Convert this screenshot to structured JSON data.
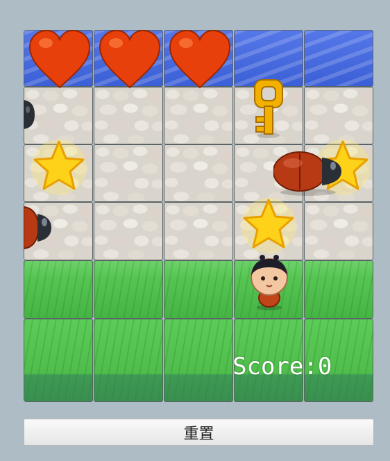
{
  "game": {
    "board": {
      "columns": 5,
      "rows": 6,
      "row_terrain": [
        "water",
        "stone",
        "stone",
        "stone",
        "grass",
        "grass"
      ]
    },
    "lives": 3,
    "items": {
      "stars": 3,
      "keys": 1
    },
    "enemies": "beetle",
    "player": "kid",
    "score": "Score:0",
    "reset_label": "重置"
  },
  "colors": {
    "background": "#aebcc5",
    "water": "#3b5fd6",
    "grass": "#4fbd4c",
    "heart": "#e8400a",
    "star": "#ffd21a",
    "key": "#f2b100",
    "beetle": "#b83a14"
  },
  "icons": [
    "heart-icon",
    "star-icon",
    "key-icon",
    "beetle-icon",
    "player-icon"
  ]
}
